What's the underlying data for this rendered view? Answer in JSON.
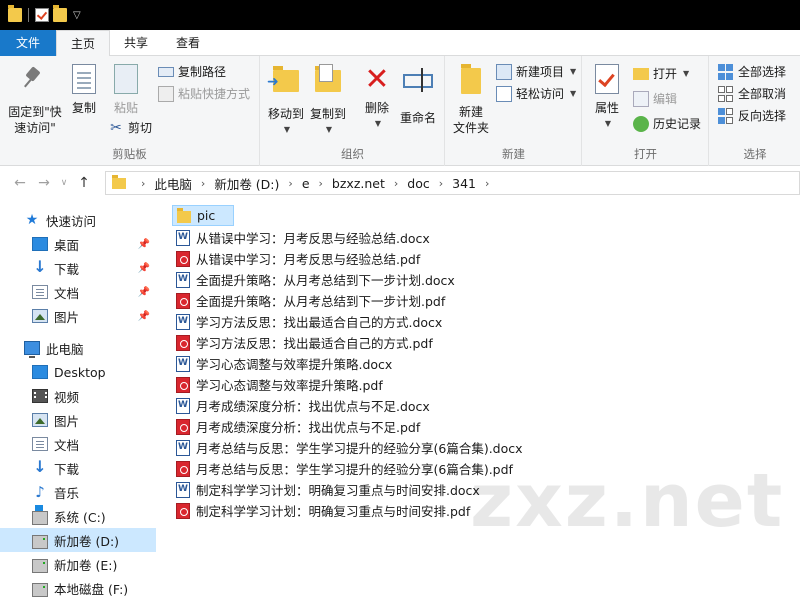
{
  "window": {
    "icons": [
      "folder-icon",
      "properties-icon",
      "new-folder-icon"
    ]
  },
  "ribbon_tabs": {
    "file": "文件",
    "home": "主页",
    "share": "共享",
    "view": "查看"
  },
  "clipboard": {
    "pin_label_1": "固定到\"快",
    "pin_label_2": "速访问\"",
    "copy": "复制",
    "paste": "粘贴",
    "copy_path": "复制路径",
    "paste_shortcut": "粘贴快捷方式",
    "cut": "剪切",
    "group": "剪贴板"
  },
  "organize": {
    "move_to": "移动到",
    "copy_to": "复制到",
    "delete": "删除",
    "rename": "重命名",
    "group": "组织"
  },
  "new": {
    "new_folder_1": "新建",
    "new_folder_2": "文件夹",
    "new_item": "新建项目",
    "easy_access": "轻松访问",
    "group": "新建"
  },
  "open": {
    "properties": "属性",
    "open": "打开",
    "edit": "编辑",
    "history": "历史记录",
    "group": "打开"
  },
  "select": {
    "select_all": "全部选择",
    "select_none": "全部取消",
    "invert": "反向选择",
    "group": "选择"
  },
  "address": {
    "crumbs": [
      "此电脑",
      "新加卷 (D:)",
      "e",
      "bzxz.net",
      "doc",
      "341"
    ]
  },
  "nav": {
    "quick_access": "快速访问",
    "qa_items": [
      "桌面",
      "下载",
      "文档",
      "图片"
    ],
    "this_pc": "此电脑",
    "pc_items": [
      "Desktop",
      "视频",
      "图片",
      "文档",
      "下载",
      "音乐",
      "系统 (C:)",
      "新加卷 (D:)",
      "新加卷 (E:)",
      "本地磁盘 (F:)"
    ]
  },
  "files": [
    {
      "name": "pic",
      "type": "folder"
    },
    {
      "name": "从错误中学习：月考反思与经验总结.docx",
      "type": "docx"
    },
    {
      "name": "从错误中学习：月考反思与经验总结.pdf",
      "type": "pdf"
    },
    {
      "name": "全面提升策略：从月考总结到下一步计划.docx",
      "type": "docx"
    },
    {
      "name": "全面提升策略：从月考总结到下一步计划.pdf",
      "type": "pdf"
    },
    {
      "name": "学习方法反思：找出最适合自己的方式.docx",
      "type": "docx"
    },
    {
      "name": "学习方法反思：找出最适合自己的方式.pdf",
      "type": "pdf"
    },
    {
      "name": "学习心态调整与效率提升策略.docx",
      "type": "docx"
    },
    {
      "name": "学习心态调整与效率提升策略.pdf",
      "type": "pdf"
    },
    {
      "name": "月考成绩深度分析：找出优点与不足.docx",
      "type": "docx"
    },
    {
      "name": "月考成绩深度分析：找出优点与不足.pdf",
      "type": "pdf"
    },
    {
      "name": "月考总结与反思：学生学习提升的经验分享(6篇合集).docx",
      "type": "docx"
    },
    {
      "name": "月考总结与反思：学生学习提升的经验分享(6篇合集).pdf",
      "type": "pdf"
    },
    {
      "name": "制定科学学习计划：明确复习重点与时间安排.docx",
      "type": "docx"
    },
    {
      "name": "制定科学学习计划：明确复习重点与时间安排.pdf",
      "type": "pdf"
    }
  ],
  "watermark": "zxz.net"
}
